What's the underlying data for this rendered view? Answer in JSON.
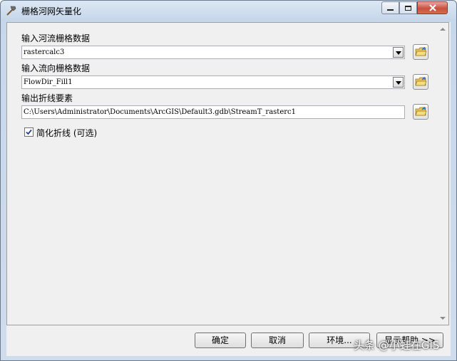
{
  "window": {
    "title": "栅格河网矢量化"
  },
  "caption_buttons": {
    "minimize": "minimize-icon",
    "maximize": "maximize-icon",
    "close": "close-icon"
  },
  "form": {
    "river_raster": {
      "label": "输入河流栅格数据",
      "value": "rastercalc3"
    },
    "flow_dir_raster": {
      "label": "输入流向栅格数据",
      "value": "FlowDir_Fill1"
    },
    "output_polyline": {
      "label": "输出折线要素",
      "value": "C:\\Users\\Administrator\\Documents\\ArcGIS\\Default3.gdb\\StreamT_rasterc1"
    },
    "simplify": {
      "label": "简化折线 (可选)",
      "checked": true
    }
  },
  "buttons": {
    "ok": "确定",
    "cancel": "取消",
    "env": "环境...",
    "help": "显示帮助 >>"
  },
  "watermark": "头条 @小蛙在GIS",
  "colors": {
    "title_bar": "#c7d7ea",
    "close_button": "#c7513d",
    "panel_bg": "#f0f0f0"
  }
}
